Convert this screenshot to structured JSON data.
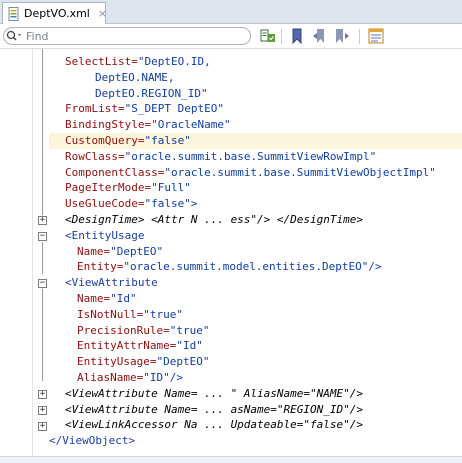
{
  "tab": {
    "title": "DeptVO.xml",
    "close": "×"
  },
  "search": {
    "placeholder": "Find"
  },
  "toolbar": {
    "icons": [
      "find-usages-icon",
      "bookmark-icon",
      "prev-bookmark-icon",
      "next-bookmark-icon",
      "source-view-icon"
    ]
  },
  "code": {
    "l1": {
      "attr": "SelectList=",
      "val": "\"DeptEO.ID,"
    },
    "l2": {
      "val": "DeptEO.NAME,"
    },
    "l3": {
      "val": "DeptEO.REGION_ID\""
    },
    "l4": {
      "attr": "FromList=",
      "val": "\"S_DEPT DeptEO\""
    },
    "l5": {
      "attr": "BindingStyle=",
      "val": "\"OracleName\""
    },
    "l6": {
      "attr": "CustomQuery=",
      "val": "\"false\""
    },
    "l7": {
      "attr": "RowClass=",
      "val": "\"oracle.summit.base.SummitViewRowImpl\""
    },
    "l8": {
      "attr": "ComponentClass=",
      "val": "\"oracle.summit.base.SummitViewObjectImpl\""
    },
    "l9": {
      "attr": "PageIterMode=",
      "val": "\"Full\""
    },
    "l10": {
      "attr": "UseGlueCode=",
      "val": "\"false\">"
    },
    "l11": {
      "text": "<DesignTime> <Attr N ... ess\"/> </DesignTime>"
    },
    "l12": {
      "tag": "<EntityUsage"
    },
    "l13": {
      "attr": "Name=",
      "val": "\"DeptEO\""
    },
    "l14": {
      "attr": "Entity=",
      "val": "\"oracle.summit.model.entities.DeptEO\"/>"
    },
    "l15": {
      "tag": "<ViewAttribute"
    },
    "l16": {
      "attr": "Name=",
      "val": "\"Id\""
    },
    "l17": {
      "attr": "IsNotNull=",
      "val": "\"true\""
    },
    "l18": {
      "attr": "PrecisionRule=",
      "val": "\"true\""
    },
    "l19": {
      "attr": "EntityAttrName=",
      "val": "\"Id\""
    },
    "l20": {
      "attr": "EntityUsage=",
      "val": "\"DeptEO\""
    },
    "l21": {
      "attr": "AliasName=",
      "val": "\"ID\"/>"
    },
    "l22": {
      "text": "<ViewAttribute Name= ... \" AliasName=\"NAME\"/>"
    },
    "l23": {
      "text": "<ViewAttribute Name= ... asName=\"REGION_ID\"/>"
    },
    "l24": {
      "text": "<ViewLinkAccessor Na ... Updateable=\"false\"/>"
    },
    "l25": {
      "tag": "</ViewObject>"
    }
  },
  "colors": {
    "attr": "#8b0f0f",
    "value": "#123d9a",
    "highlight": "#fcf5dc"
  }
}
